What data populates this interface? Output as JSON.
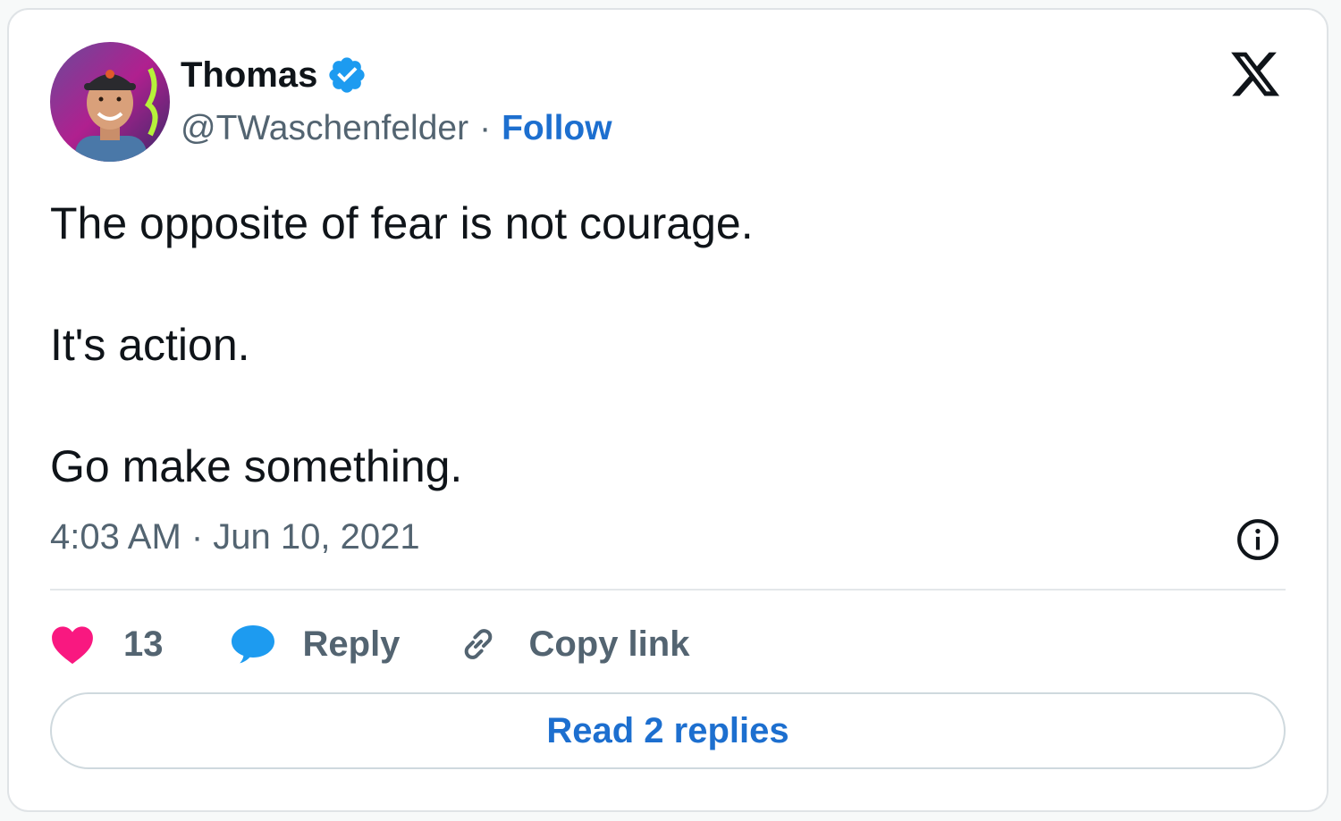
{
  "author": {
    "name": "Thomas",
    "handle": "@TWaschenfelder",
    "separator": "·",
    "follow_label": "Follow",
    "verified": true,
    "verified_color": "#1d9bf0"
  },
  "tweet": {
    "lines": [
      "The opposite of fear is not courage.",
      "It's action.",
      "Go make something."
    ],
    "timestamp": "4:03 AM · Jun 10, 2021"
  },
  "actions": {
    "like_count": "13",
    "reply_label": "Reply",
    "copy_link_label": "Copy link",
    "like_color": "#f91880",
    "reply_color": "#1d9bf0"
  },
  "read_replies_label": "Read 2 replies",
  "icons": {
    "platform_logo": "x-logo-icon",
    "info": "info-icon",
    "like": "heart-icon",
    "reply": "speech-bubble-icon",
    "copy": "link-icon",
    "verified": "verified-badge-icon"
  }
}
